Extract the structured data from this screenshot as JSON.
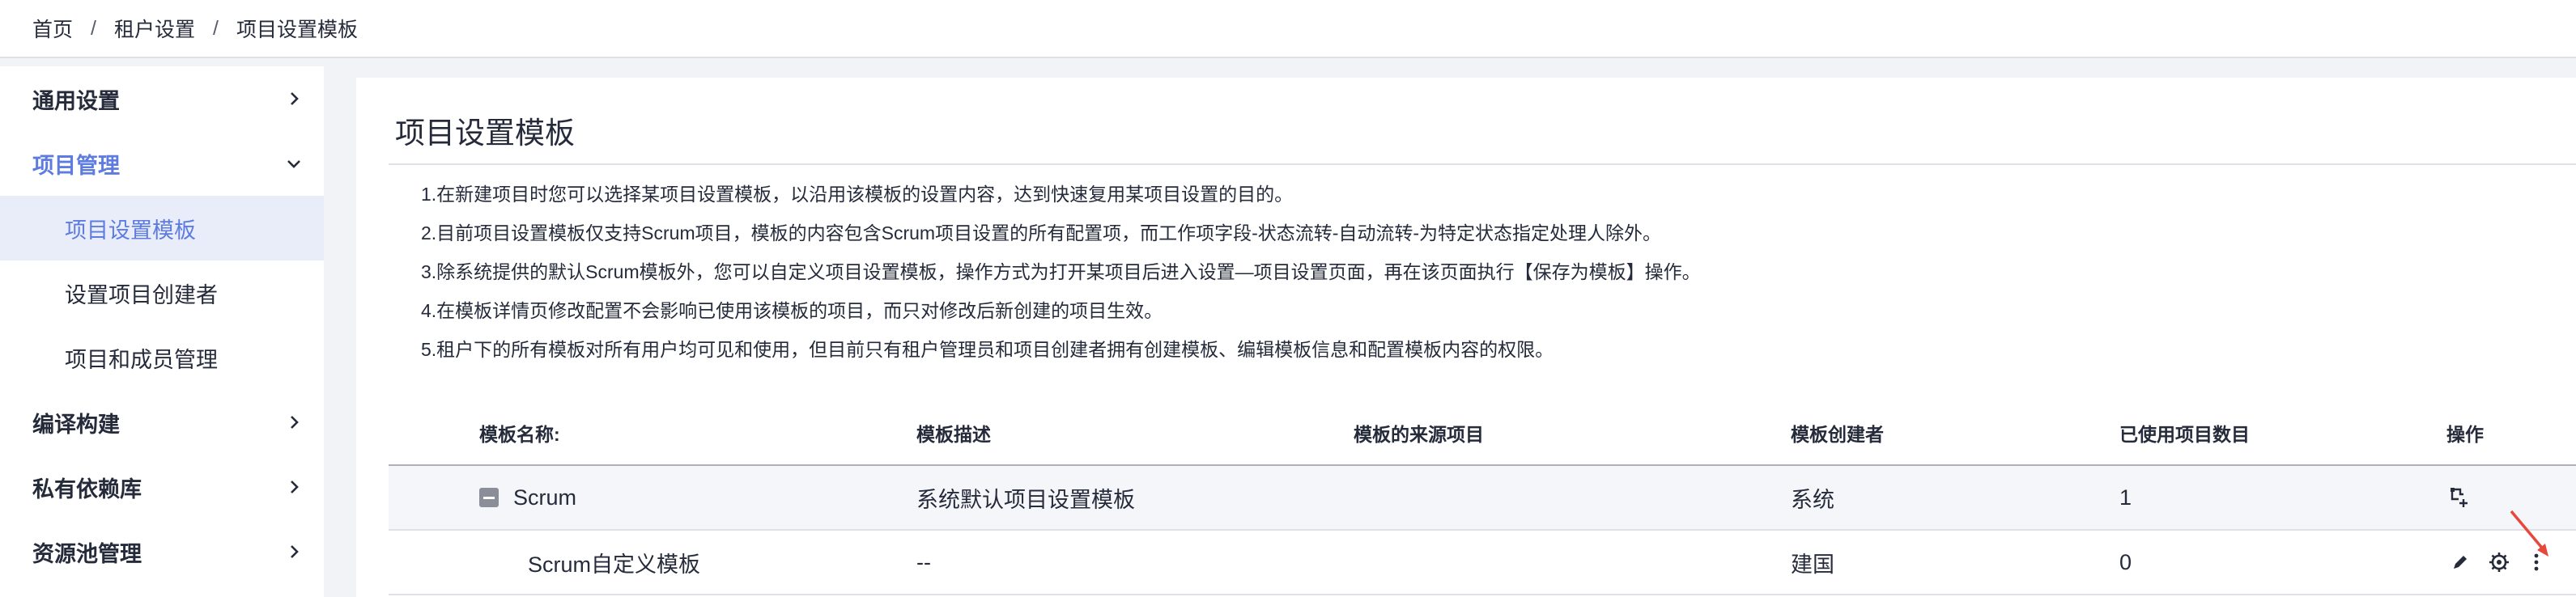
{
  "breadcrumb": [
    "首页",
    "租户设置",
    "项目设置模板"
  ],
  "breadcrumb_separator": "/",
  "sidebar": {
    "groups": [
      {
        "label": "通用设置",
        "expanded": false
      },
      {
        "label": "项目管理",
        "expanded": true,
        "items": [
          {
            "label": "项目设置模板",
            "active": true
          },
          {
            "label": "设置项目创建者"
          },
          {
            "label": "项目和成员管理"
          }
        ]
      },
      {
        "label": "编译构建",
        "expanded": false
      },
      {
        "label": "私有依赖库",
        "expanded": false
      },
      {
        "label": "资源池管理",
        "expanded": false
      }
    ]
  },
  "page": {
    "title": "项目设置模板",
    "notices": [
      "1.在新建项目时您可以选择某项目设置模板，以沿用该模板的设置内容，达到快速复用某项目设置的目的。",
      "2.目前项目设置模板仅支持Scrum项目，模板的内容包含Scrum项目设置的所有配置项，而工作项字段-状态流转-自动流转-为特定状态指定处理人除外。",
      "3.除系统提供的默认Scrum模板外，您可以自定义项目设置模板，操作方式为打开某项目后进入设置—项目设置页面，再在该页面执行【保存为模板】操作。",
      "4.在模板详情页修改配置不会影响已使用该模板的项目，而只对修改后新创建的项目生效。",
      "5.租户下的所有模板对所有用户均可见和使用，但目前只有租户管理员和项目创建者拥有创建模板、编辑模板信息和配置模板内容的权限。"
    ]
  },
  "table": {
    "headers": {
      "name": "模板名称:",
      "desc": "模板描述",
      "source": "模板的来源项目",
      "creator": "模板创建者",
      "count": "已使用项目数目",
      "ops": "操作"
    },
    "group_row": {
      "name": "Scrum",
      "desc": "系统默认项目设置模板",
      "source": "",
      "creator": "系统",
      "count": "1"
    },
    "child_row": {
      "name": "Scrum自定义模板",
      "desc": "--",
      "source": "",
      "creator": "建国",
      "count": "0"
    }
  },
  "colors": {
    "accent": "#5e7ce0",
    "active_bg": "#e9edfa",
    "annotation_arrow": "#e8473c"
  }
}
